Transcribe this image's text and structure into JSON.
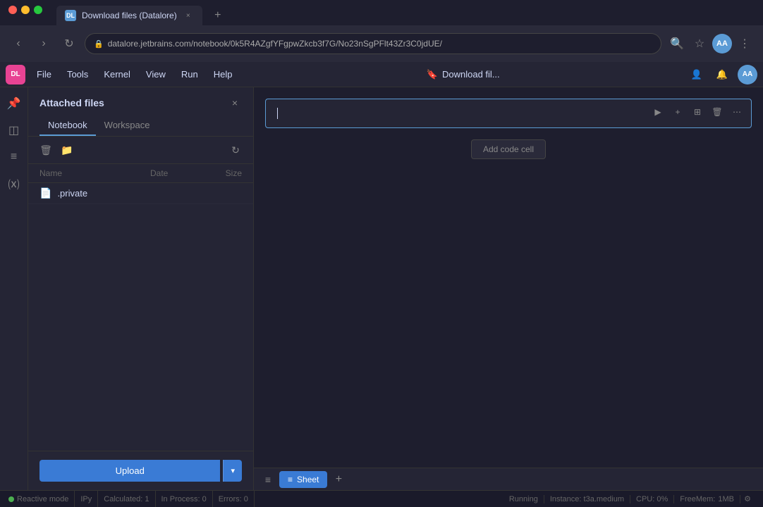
{
  "browser": {
    "tab_title": "Download files (Datalore)",
    "tab_icon": "DL",
    "url": "datalore.jetbrains.com/notebook/0k5R4AZgfYFgpwZkcb3f7G/No23nSgPFlt43Zr3C0jdUE/",
    "new_tab_label": "+",
    "nav": {
      "back": "‹",
      "forward": "›",
      "refresh": "↻"
    },
    "toolbar": {
      "search": "🔍",
      "bookmark": "☆",
      "profile": "AA",
      "more": "⋮"
    }
  },
  "menu": {
    "logo": "DL",
    "items": [
      "File",
      "Tools",
      "Kernel",
      "View",
      "Run",
      "Help"
    ],
    "notebook_title": "Download fil...",
    "bookmark_icon": "🔖",
    "right": {
      "share_icon": "👤",
      "bell_icon": "🔔",
      "avatar": "AA"
    }
  },
  "sidebar": {
    "icons": [
      {
        "name": "pin-icon",
        "glyph": "📌"
      },
      {
        "name": "layers-icon",
        "glyph": "◫"
      },
      {
        "name": "list-icon",
        "glyph": "≡"
      },
      {
        "name": "variable-icon",
        "glyph": "⒳"
      }
    ]
  },
  "file_panel": {
    "title": "Attached files",
    "close_label": "×",
    "tabs": [
      {
        "label": "Notebook",
        "active": true
      },
      {
        "label": "Workspace",
        "active": false
      }
    ],
    "toolbar": {
      "delete_icon": "🗑",
      "folder_icon": "📁",
      "refresh_icon": "↻"
    },
    "columns": {
      "name": "Name",
      "date": "Date",
      "size": "Size"
    },
    "files": [
      {
        "icon": "📄",
        "name": ".private",
        "date": "",
        "size": ""
      }
    ],
    "upload_label": "Upload",
    "upload_dropdown": "▾"
  },
  "notebook": {
    "cell": {
      "run_icon": "▶",
      "add_icon": "+",
      "split_icon": "⊞",
      "delete_icon": "🗑",
      "more_icon": "⋯",
      "placeholder": ""
    },
    "add_cell_label": "Add code cell"
  },
  "sheets": {
    "menu_icon": "≡",
    "tabs": [
      {
        "label": "Sheet",
        "active": true,
        "icon": "≡"
      }
    ],
    "add_label": "+"
  },
  "status_bar": {
    "reactive_mode": "Reactive mode",
    "ipy": "IPy",
    "calculated": "Calculated: 1",
    "in_process": "In Process: 0",
    "errors": "Errors: 0",
    "running": "Running",
    "instance": "Instance: t3a.medium",
    "cpu": "CPU:  0%",
    "free_mem": "FreeMem:",
    "mem_val": "1MB",
    "settings_icon": "⚙"
  }
}
